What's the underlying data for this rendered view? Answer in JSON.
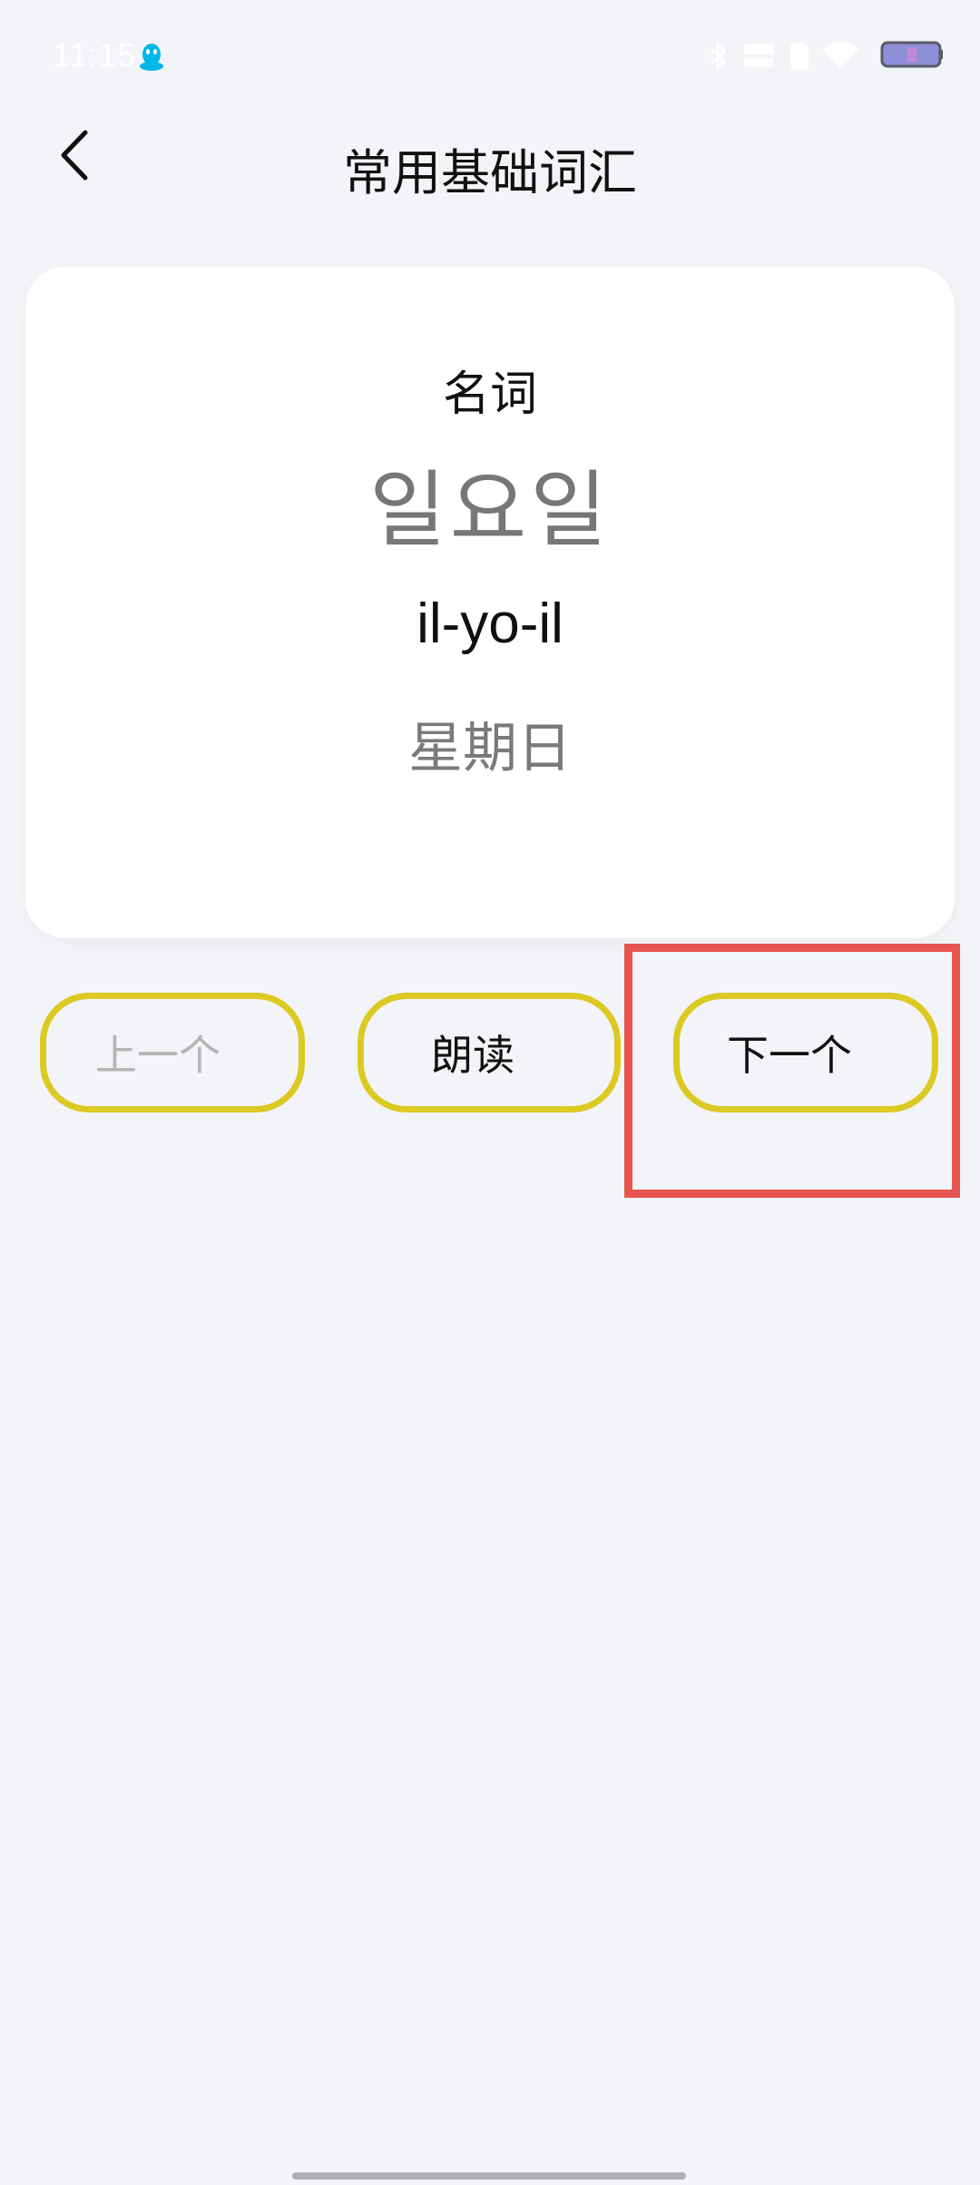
{
  "status_bar": {
    "time": "11:15",
    "icons": [
      "qq-penguin-icon",
      "bluetooth-icon",
      "network-speed-icon",
      "sim-icon",
      "wifi-icon",
      "battery-icon"
    ],
    "accent_color": "#00b8e6"
  },
  "header": {
    "title": "常用基础词汇",
    "back_icon": "chevron-left-icon"
  },
  "card": {
    "part_of_speech": "名词",
    "korean": "일요일",
    "romanization": "il-yo-il",
    "meaning": "星期日"
  },
  "buttons": {
    "prev_label": "上一个",
    "read_label": "朗读",
    "next_label": "下一个"
  },
  "colors": {
    "background": "#f3f4f8",
    "card": "#ffffff",
    "button_border": "#dcc922",
    "highlight": "#e85550",
    "disabled_text": "#b4b4b4"
  }
}
